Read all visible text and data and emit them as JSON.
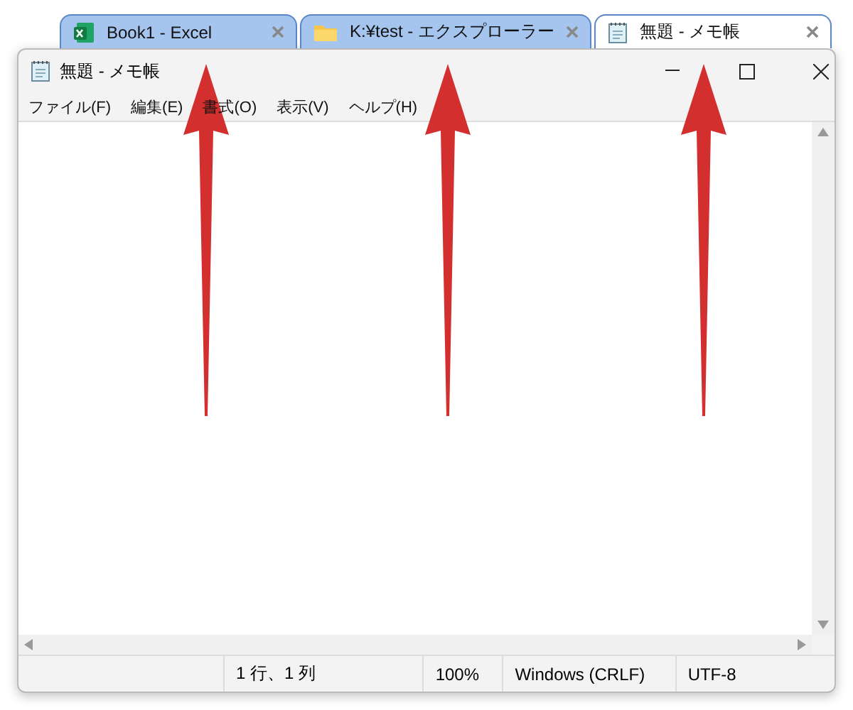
{
  "tabs": [
    {
      "label": "Book1 - Excel",
      "kind": "excel",
      "selected": false
    },
    {
      "label": "K:¥test - エクスプローラー",
      "kind": "folder",
      "selected": false
    },
    {
      "label": "無題 - メモ帳",
      "kind": "notepad",
      "selected": true
    }
  ],
  "window": {
    "title": "無題 - メモ帳"
  },
  "menu": [
    "ファイル(F)",
    "編集(E)",
    "書式(O)",
    "表示(V)",
    "ヘルプ(H)"
  ],
  "status_bar": [
    "1 行、1 列",
    "100%",
    "Windows (CRLF)",
    "UTF-8"
  ],
  "annotations": [
    {
      "kind": "arrow"
    },
    {
      "kind": "arrow"
    },
    {
      "kind": "arrow"
    }
  ]
}
